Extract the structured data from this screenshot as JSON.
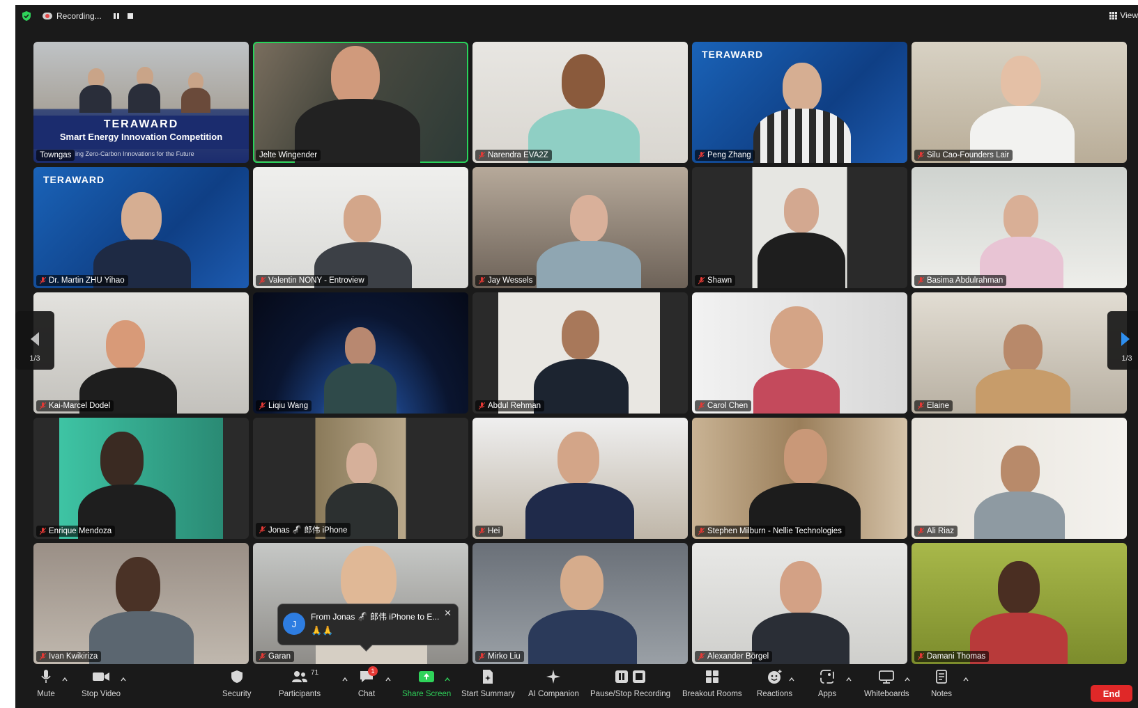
{
  "topbar": {
    "recording_label": "Recording...",
    "view_label": "View"
  },
  "participants": [
    {
      "name": "Towngas"
    },
    {
      "name": "Jelte Wingender"
    },
    {
      "name": "Narendra EVA2Z"
    },
    {
      "name": "Peng Zhang"
    },
    {
      "name": "Silu Cao-Founders Lair"
    },
    {
      "name": "Dr. Martin ZHU Yihao"
    },
    {
      "name": "Valentin NONY - Entroview"
    },
    {
      "name": "Jay Wessels"
    },
    {
      "name": "Shawn"
    },
    {
      "name": "Basima Abdulrahman"
    },
    {
      "name": "Kai-Marcel Dodel"
    },
    {
      "name": "Liqiu Wang"
    },
    {
      "name": "Abdul Rehman"
    },
    {
      "name": "Carol Chen"
    },
    {
      "name": "Elaine"
    },
    {
      "name": "Enrique Mendoza"
    },
    {
      "name": "Jonas 🦨 郎伟 iPhone"
    },
    {
      "name": "Hei"
    },
    {
      "name": "Stephen Milburn - Nellie Technologies"
    },
    {
      "name": "Ali Riaz"
    },
    {
      "name": "Ivan Kwikiriza"
    },
    {
      "name": "Garan"
    },
    {
      "name": "Mirko Liu"
    },
    {
      "name": "Alexander Börgel"
    },
    {
      "name": "Damani Thomas"
    }
  ],
  "banner": {
    "logo": "TERAWARD",
    "line1": "Smart Energy Innovation Competition",
    "line2": "ing Zero-Carbon Innovations for the Future"
  },
  "tile_logo": "TERAWARD",
  "pagination": {
    "left": "1/3",
    "right": "1/3"
  },
  "toast": {
    "avatar": "J",
    "title": "From Jonas 🦨 郎伟 iPhone to E...",
    "message": "🙏🙏"
  },
  "toolbar": {
    "mute": "Mute",
    "stop_video": "Stop Video",
    "security": "Security",
    "participants": "Participants",
    "participants_count": "71",
    "chat": "Chat",
    "chat_badge": "1",
    "share_screen": "Share Screen",
    "start_summary": "Start Summary",
    "ai_companion": "AI Companion",
    "pause_stop_recording": "Pause/Stop Recording",
    "breakout_rooms": "Breakout Rooms",
    "reactions": "Reactions",
    "apps": "Apps",
    "whiteboards": "Whiteboards",
    "notes": "Notes",
    "end": "End"
  },
  "colors": {
    "accent_green": "#2fd35a",
    "end_red": "#e02828",
    "speaking_outline": "#28d35a"
  }
}
